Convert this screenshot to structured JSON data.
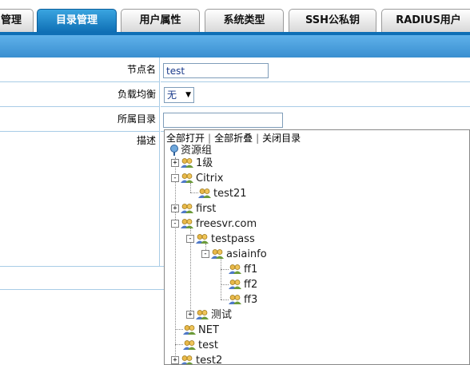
{
  "tabs": [
    {
      "label": "管理",
      "active": false
    },
    {
      "label": "目录管理",
      "active": true
    },
    {
      "label": "用户属性",
      "active": false
    },
    {
      "label": "系统类型",
      "active": false
    },
    {
      "label": "SSH公私钥",
      "active": false
    },
    {
      "label": "RADIUS用户",
      "active": false
    }
  ],
  "form": {
    "node_name_label": "节点名",
    "node_name_value": "test",
    "load_balance_label": "负载均衡",
    "load_balance_value": "无",
    "directory_label": "所属目录",
    "directory_value": "",
    "description_label": "描述"
  },
  "tree": {
    "expand_all": "全部打开",
    "collapse_all": "全部折叠",
    "close": "关闭目录",
    "separator": "|",
    "root": "资源组",
    "nodes": [
      {
        "label": "1级",
        "toggle": "+"
      },
      {
        "label": "Citrix",
        "toggle": "-"
      },
      {
        "label": "test21",
        "toggle": ""
      },
      {
        "label": "first",
        "toggle": "+"
      },
      {
        "label": "freesvr.com",
        "toggle": "-"
      },
      {
        "label": "testpass",
        "toggle": "-"
      },
      {
        "label": "asiainfo",
        "toggle": "-"
      },
      {
        "label": "ff1",
        "toggle": ""
      },
      {
        "label": "ff2",
        "toggle": ""
      },
      {
        "label": "ff3",
        "toggle": ""
      },
      {
        "label": "测试",
        "toggle": "+"
      },
      {
        "label": "NET",
        "toggle": ""
      },
      {
        "label": "test",
        "toggle": ""
      },
      {
        "label": "test2",
        "toggle": "+"
      }
    ]
  },
  "colors": {
    "accent": "#0f6fb5",
    "header_bar": "#4a9fdf",
    "cell_border": "#a8cce6",
    "input_text": "#1a3a8a"
  }
}
